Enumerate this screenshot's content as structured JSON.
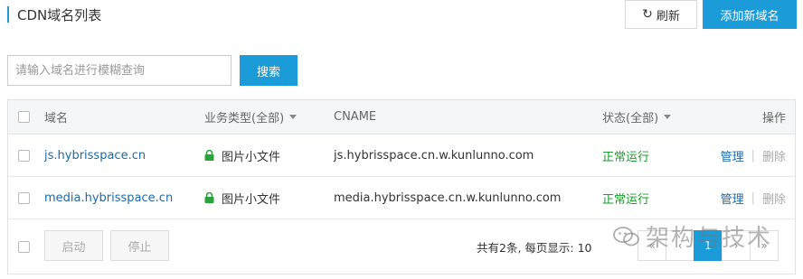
{
  "header": {
    "title": "CDN域名列表",
    "refresh_label": "刷新",
    "add_label": "添加新域名"
  },
  "search": {
    "placeholder": "请输入域名进行模糊查询",
    "value": "",
    "button_label": "搜索"
  },
  "table": {
    "columns": {
      "domain": "域名",
      "type": "业务类型(全部)",
      "cname": "CNAME",
      "status": "状态(全部)",
      "ops": "操作"
    },
    "rows": [
      {
        "domain": "js.hybrisspace.cn",
        "type": "图片小文件",
        "cname": "js.hybrisspace.cn.w.kunlunno.com",
        "status": "正常运行",
        "manage": "管理",
        "delete": "删除"
      },
      {
        "domain": "media.hybrisspace.cn",
        "type": "图片小文件",
        "cname": "media.hybrisspace.cn.w.kunlunno.com",
        "status": "正常运行",
        "manage": "管理",
        "delete": "删除"
      }
    ]
  },
  "footer": {
    "start_label": "启动",
    "stop_label": "停止",
    "summary": "共有2条,  每页显示: 10",
    "pages": [
      "«",
      "‹",
      "1",
      "›",
      "»"
    ],
    "current_page": "1"
  },
  "watermark": {
    "text": "架构与技术"
  },
  "colors": {
    "accent": "#1b9bd7",
    "link": "#1b6aa8",
    "status_ok": "#1a9b2d",
    "lock": "#2aa33a"
  },
  "icons": {
    "refresh": "refresh-icon",
    "lock": "lock-icon",
    "caret": "caret-down-icon",
    "watermark": "wechat-icon"
  }
}
